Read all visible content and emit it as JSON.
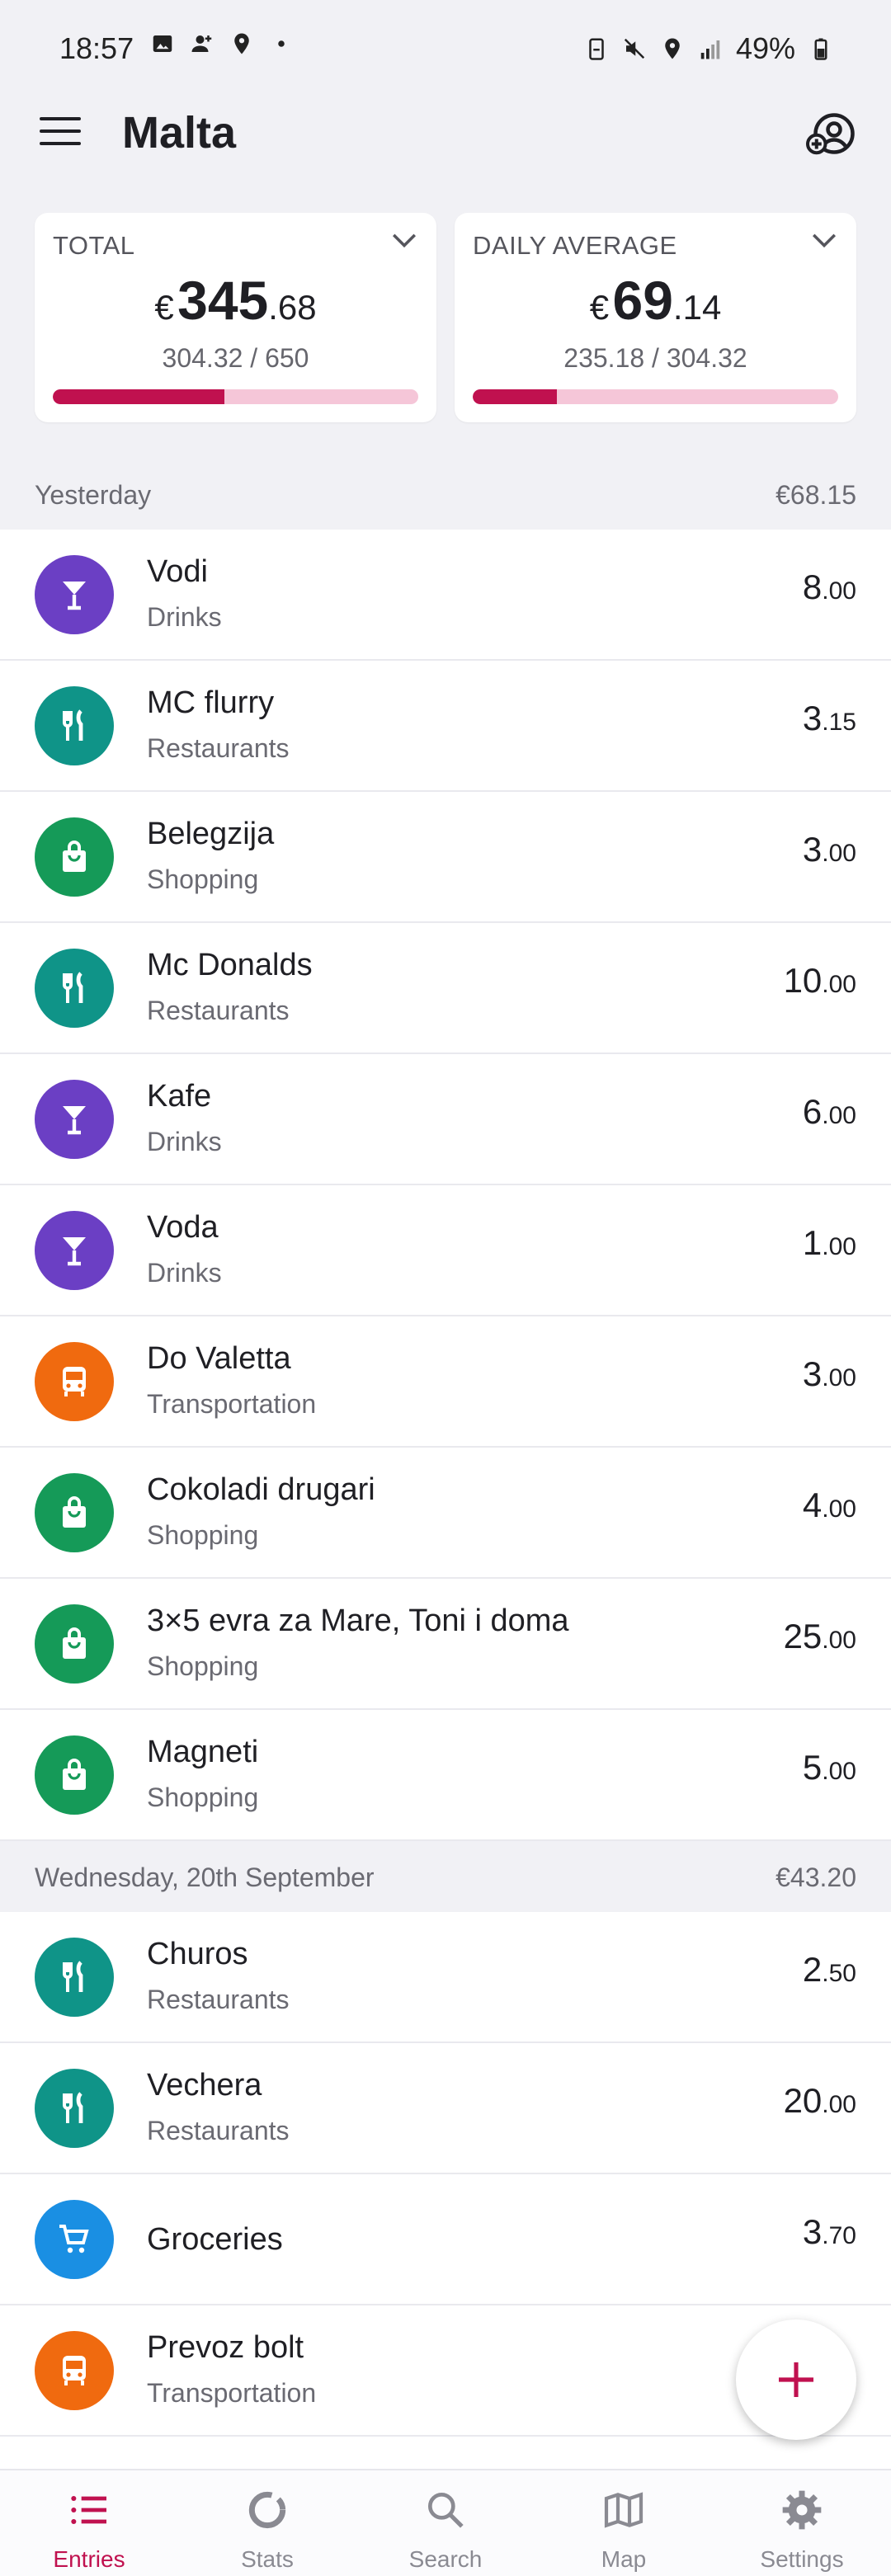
{
  "status_bar": {
    "time": "18:57",
    "battery": "49%"
  },
  "app": {
    "title": "Malta"
  },
  "summary": {
    "total": {
      "label": "TOTAL",
      "currency": "€",
      "int": "345",
      "dec": ".68",
      "sub": "304.32 /  650",
      "progress": 0.47
    },
    "daily": {
      "label": "DAILY AVERAGE",
      "currency": "€",
      "int": "69",
      "dec": ".14",
      "sub": "235.18 /  304.32",
      "progress": 0.23
    }
  },
  "sections": [
    {
      "date": "Yesterday",
      "total": "€68.15",
      "entries": [
        {
          "name": "Vodi",
          "category": "Drinks",
          "icon": "cocktail-icon",
          "color": "#6b3fc4",
          "amount_int": "8",
          "amount_dec": ".00"
        },
        {
          "name": "MC flurry",
          "category": "Restaurants",
          "icon": "fork-knife-icon",
          "color": "#0f9488",
          "amount_int": "3",
          "amount_dec": ".15"
        },
        {
          "name": "Belegzija",
          "category": "Shopping",
          "icon": "shopping-bag-icon",
          "color": "#159a58",
          "amount_int": "3",
          "amount_dec": ".00"
        },
        {
          "name": "Mc Donalds",
          "category": "Restaurants",
          "icon": "fork-knife-icon",
          "color": "#0f9488",
          "amount_int": "10",
          "amount_dec": ".00"
        },
        {
          "name": "Kafe",
          "category": "Drinks",
          "icon": "cocktail-icon",
          "color": "#6b3fc4",
          "amount_int": "6",
          "amount_dec": ".00"
        },
        {
          "name": "Voda",
          "category": "Drinks",
          "icon": "cocktail-icon",
          "color": "#6b3fc4",
          "amount_int": "1",
          "amount_dec": ".00"
        },
        {
          "name": "Do Valetta",
          "category": "Transportation",
          "icon": "bus-icon",
          "color": "#f06a0f",
          "amount_int": "3",
          "amount_dec": ".00"
        },
        {
          "name": "Cokoladi drugari",
          "category": "Shopping",
          "icon": "shopping-bag-icon",
          "color": "#159a58",
          "amount_int": "4",
          "amount_dec": ".00"
        },
        {
          "name": "3×5 evra za Mare, Toni i doma",
          "category": "Shopping",
          "icon": "shopping-bag-icon",
          "color": "#159a58",
          "amount_int": "25",
          "amount_dec": ".00"
        },
        {
          "name": "Magneti",
          "category": "Shopping",
          "icon": "shopping-bag-icon",
          "color": "#159a58",
          "amount_int": "5",
          "amount_dec": ".00"
        }
      ]
    },
    {
      "date": "Wednesday, 20th September",
      "total": "€43.20",
      "entries": [
        {
          "name": "Churos",
          "category": "Restaurants",
          "icon": "fork-knife-icon",
          "color": "#0f9488",
          "amount_int": "2",
          "amount_dec": ".50"
        },
        {
          "name": "Vechera",
          "category": "Restaurants",
          "icon": "fork-knife-icon",
          "color": "#0f9488",
          "amount_int": "20",
          "amount_dec": ".00"
        },
        {
          "name": "Groceries",
          "category": "",
          "icon": "cart-icon",
          "color": "#1a8fe3",
          "amount_int": "3",
          "amount_dec": ".70"
        },
        {
          "name": "Prevoz bolt",
          "category": "Transportation",
          "icon": "bus-icon",
          "color": "#f06a0f",
          "amount_int": "",
          "amount_dec": ""
        }
      ]
    }
  ],
  "nav": [
    {
      "label": "Entries",
      "icon": "list-icon",
      "active": true
    },
    {
      "label": "Stats",
      "icon": "donut-chart-icon",
      "active": false
    },
    {
      "label": "Search",
      "icon": "search-icon",
      "active": false
    },
    {
      "label": "Map",
      "icon": "map-icon",
      "active": false
    },
    {
      "label": "Settings",
      "icon": "gear-icon",
      "active": false
    }
  ],
  "colors": {
    "accent": "#c0114f",
    "progress_track": "#f5c6d8",
    "background": "#f1f1f5"
  }
}
